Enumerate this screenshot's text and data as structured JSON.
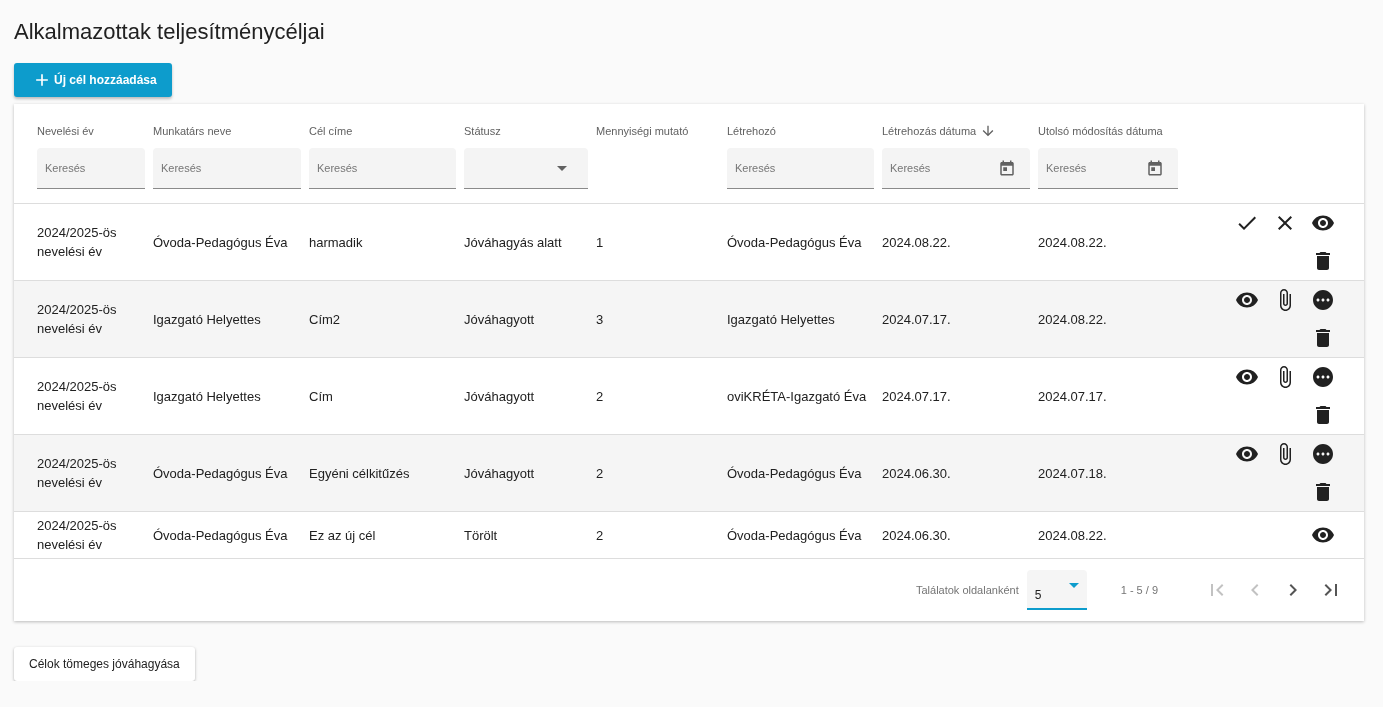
{
  "title": "Alkalmazottak teljesítménycéljai",
  "add_button": {
    "label": "Új cél hozzáadása"
  },
  "table": {
    "columns": [
      {
        "label": "Nevelési év",
        "sorted": false,
        "filter": {
          "kind": "text",
          "placeholder": "Keresés"
        }
      },
      {
        "label": "Munkatárs neve",
        "sorted": false,
        "filter": {
          "kind": "text",
          "placeholder": "Keresés"
        }
      },
      {
        "label": "Cél címe",
        "sorted": false,
        "filter": {
          "kind": "text",
          "placeholder": "Keresés"
        }
      },
      {
        "label": "Státusz",
        "sorted": false,
        "filter": {
          "kind": "select"
        }
      },
      {
        "label": "Mennyiségi mutató",
        "sorted": false,
        "filter": {
          "kind": "none"
        }
      },
      {
        "label": "Létrehozó",
        "sorted": false,
        "filter": {
          "kind": "text",
          "placeholder": "Keresés"
        }
      },
      {
        "label": "Létrehozás dátuma",
        "sorted": true,
        "filter": {
          "kind": "date",
          "placeholder": "Keresés"
        }
      },
      {
        "label": "Utolsó módosítás dátuma",
        "sorted": false,
        "filter": {
          "kind": "date",
          "placeholder": "Keresés"
        }
      }
    ],
    "rows": [
      {
        "cells": [
          "2024/2025-ös nevelési év",
          "Óvoda-Pedagógus Éva",
          "harmadik",
          "Jóváhagyás alatt",
          "1",
          "Óvoda-Pedagógus Éva",
          "2024.08.22.",
          "2024.08.22."
        ],
        "actions": [
          [
            {
              "kind": "check"
            },
            {
              "kind": "close"
            },
            {
              "kind": "eye"
            }
          ],
          [
            {
              "kind": "trash"
            }
          ]
        ]
      },
      {
        "cells": [
          "2024/2025-ös nevelési év",
          "Igazgató Helyettes",
          "Cím2",
          "Jóváhagyott",
          "3",
          "Igazgató Helyettes",
          "2024.07.17.",
          "2024.08.22."
        ],
        "actions": [
          [
            {
              "kind": "eye"
            },
            {
              "kind": "clip"
            },
            {
              "kind": "more"
            }
          ],
          [
            {
              "kind": "trash"
            }
          ]
        ]
      },
      {
        "cells": [
          "2024/2025-ös nevelési év",
          "Igazgató Helyettes",
          "Cím",
          "Jóváhagyott",
          "2",
          "oviKRÉTA-Igazgató Éva",
          "2024.07.17.",
          "2024.07.17."
        ],
        "actions": [
          [
            {
              "kind": "eye"
            },
            {
              "kind": "clip"
            },
            {
              "kind": "more"
            }
          ],
          [
            {
              "kind": "trash"
            }
          ]
        ]
      },
      {
        "cells": [
          "2024/2025-ös nevelési év",
          "Óvoda-Pedagógus Éva",
          "Egyéni célkitűzés",
          "Jóváhagyott",
          "2",
          "Óvoda-Pedagógus Éva",
          "2024.06.30.",
          "2024.07.18."
        ],
        "actions": [
          [
            {
              "kind": "eye"
            },
            {
              "kind": "clip"
            },
            {
              "kind": "more"
            }
          ],
          [
            {
              "kind": "trash"
            }
          ]
        ]
      },
      {
        "cells": [
          "2024/2025-ös nevelési év",
          "Óvoda-Pedagógus Éva",
          "Ez az új cél",
          "Törölt",
          "2",
          "Óvoda-Pedagógus Éva",
          "2024.06.30.",
          "2024.08.22."
        ],
        "actions": [
          [
            {
              "kind": "eye"
            }
          ]
        ]
      }
    ]
  },
  "paginator": {
    "page_size_label": "Találatok oldalanként",
    "page_size": "5",
    "range": "1 - 5 / 9",
    "buttons": [
      {
        "kind": "first",
        "disabled": true
      },
      {
        "kind": "prev",
        "disabled": true
      },
      {
        "kind": "next",
        "disabled": false
      },
      {
        "kind": "last",
        "disabled": false
      }
    ]
  },
  "bulk_button": {
    "label": "Célok tömeges jóváhagyása"
  }
}
